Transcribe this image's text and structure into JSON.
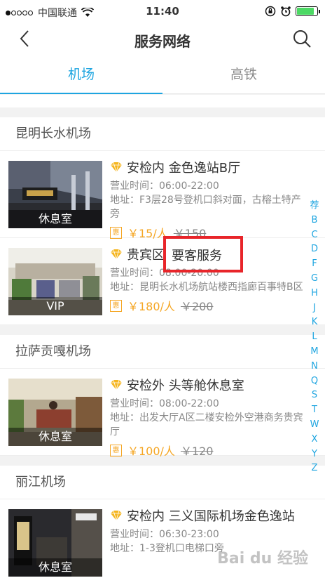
{
  "status_bar": {
    "carrier": "中国联通",
    "time": "11:40"
  },
  "nav": {
    "title": "服务网络"
  },
  "tabs": [
    {
      "label": "机场"
    },
    {
      "label": "高铁"
    }
  ],
  "sections": [
    {
      "title": "昆明长水机场",
      "items": [
        {
          "caption": "休息室",
          "name": "安检内 金色逸站B厅",
          "hours": "营业时间：06:00-22:00",
          "address": "地址：F3层28号登机口斜对面，古榕土特产旁",
          "badge": "惠",
          "price": "￥15/人",
          "original_price": "￥150"
        },
        {
          "caption": "VIP",
          "name": "贵宾区",
          "hours": "营业时间：08:00-20:00",
          "address": "地址：昆明长水机场航站楼西指廊百事特B区",
          "badge": "惠",
          "price": "￥180/人",
          "original_price": "￥200"
        }
      ]
    },
    {
      "title": "拉萨贡嘎机场",
      "items": [
        {
          "caption": "休息室",
          "name": "安检外 头等舱休息室",
          "hours": "营业时间：08:00-22:00",
          "address": "地址：出发大厅A区二楼安检外空港商务贵宾厅",
          "badge": "惠",
          "price": "￥100/人",
          "original_price": "￥120"
        }
      ]
    },
    {
      "title": "丽江机场",
      "items": [
        {
          "caption": "休息室",
          "name": "安检内 三义国际机场金色逸站",
          "hours": "营业时间：06:30-23:00",
          "address": "地址：1-3登机口电梯口旁"
        }
      ]
    }
  ],
  "highlight": {
    "text": "要客服务",
    "color": "#e8252a"
  },
  "index": [
    "荐",
    "B",
    "C",
    "D",
    "F",
    "G",
    "H",
    "J",
    "K",
    "L",
    "M",
    "N",
    "Q",
    "S",
    "T",
    "W",
    "X",
    "Y",
    "Z"
  ],
  "accent_color": "#1ea5e0",
  "price_color": "#f5a623",
  "watermark": "Bai du 经验"
}
